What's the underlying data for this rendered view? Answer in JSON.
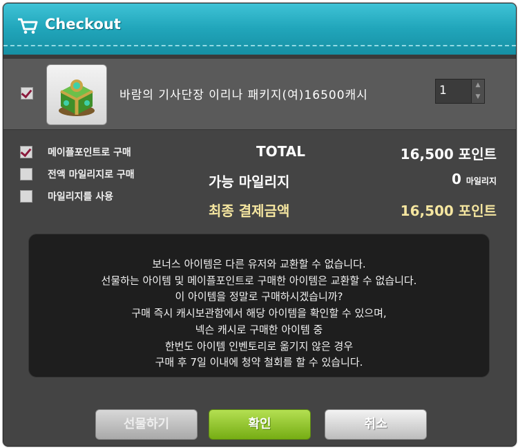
{
  "window": {
    "title": "Checkout",
    "icon": "cart-icon"
  },
  "item": {
    "checked": true,
    "icon": "item-package-icon",
    "name": "바람의 기사단장 이리나 패키지(여)16500캐시",
    "quantity": "1"
  },
  "options": [
    {
      "label": "메이플포인트로 구매",
      "checked": true
    },
    {
      "label": "전액 마일리지로 구매",
      "checked": false
    },
    {
      "label": "마일리지를 사용",
      "checked": false
    }
  ],
  "summary": {
    "total_label": "TOTAL",
    "total_value": "16,500 포인트",
    "mileage_label": "가능 마일리지",
    "mileage_value": "0",
    "mileage_unit": "마일리지",
    "final_label": "최종 결제금액",
    "final_value": "16,500 포인트",
    "highlight_color": "#f5e6a0"
  },
  "notice": [
    "보너스 아이템은 다른 유저와 교환할 수 없습니다.",
    "선물하는 아이템 및 메이플포인트로 구매한 아이템은 교환할 수 없습니다.",
    "이 아이템을 정말로 구매하시겠습니까?",
    "구매 즉시 캐시보관함에서 해당 아이템을 확인할 수 있으며,",
    "넥슨 캐시로 구매한 아이템 중",
    "한번도 아이템 인벤토리로 옮기지 않은 경우",
    "구매 후 7일 이내에 청약 철회를 할 수 있습니다."
  ],
  "buttons": {
    "gift": "선물하기",
    "confirm": "확인",
    "cancel": "취소"
  },
  "colors": {
    "title_bar": "#21a6bb",
    "confirm": "#8bc22a",
    "check": "#8b1a3c"
  }
}
